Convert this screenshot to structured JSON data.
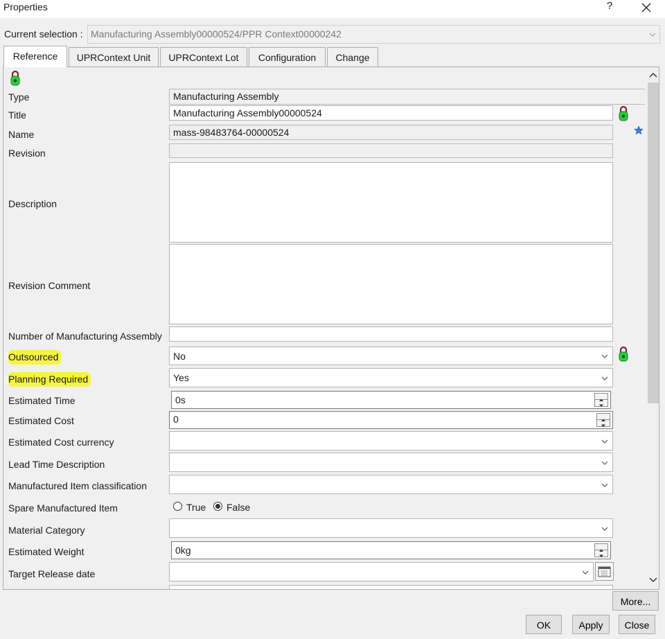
{
  "window": {
    "title": "Properties",
    "help_label": "?"
  },
  "selection": {
    "label": "Current selection :",
    "value": "Manufacturing Assembly00000524/PPR Context00000242"
  },
  "tabs": [
    {
      "label": "Reference",
      "active": true
    },
    {
      "label": "UPRContext Unit"
    },
    {
      "label": "UPRContext Lot"
    },
    {
      "label": "Configuration"
    },
    {
      "label": "Change"
    }
  ],
  "fields": {
    "type": {
      "label": "Type",
      "value": "Manufacturing Assembly"
    },
    "title": {
      "label": "Title",
      "value": "Manufacturing Assembly00000524"
    },
    "name": {
      "label": "Name",
      "value": "mass-98483764-00000524"
    },
    "revision": {
      "label": "Revision",
      "value": ""
    },
    "description": {
      "label": "Description",
      "value": ""
    },
    "revision_comment": {
      "label": "Revision Comment",
      "value": ""
    },
    "number_of_ma": {
      "label": "Number of Manufacturing Assembly",
      "value": ""
    },
    "outsourced": {
      "label": "Outsourced",
      "value": "No"
    },
    "planning_required": {
      "label": "Planning Required",
      "value": "Yes"
    },
    "estimated_time": {
      "label": "Estimated Time",
      "value": "0s"
    },
    "estimated_cost": {
      "label": "Estimated Cost",
      "value": "0"
    },
    "estimated_cost_currency": {
      "label": "Estimated Cost currency",
      "value": ""
    },
    "lead_time_description": {
      "label": "Lead Time Description",
      "value": ""
    },
    "mi_classification": {
      "label": "Manufactured Item classification",
      "value": ""
    },
    "spare_mi": {
      "label": "Spare Manufactured Item",
      "option_true": "True",
      "option_false": "False",
      "selected": "False"
    },
    "material_category": {
      "label": "Material Category",
      "value": ""
    },
    "estimated_weight": {
      "label": "Estimated Weight",
      "value": "0kg"
    },
    "target_release_date": {
      "label": "Target Release date",
      "value": ""
    }
  },
  "buttons": {
    "more": "More...",
    "ok": "OK",
    "apply": "Apply",
    "close": "Close"
  },
  "colors": {
    "highlight": "#f5f541",
    "lock_green": "#2ecc40",
    "star_blue": "#3b82d9"
  }
}
